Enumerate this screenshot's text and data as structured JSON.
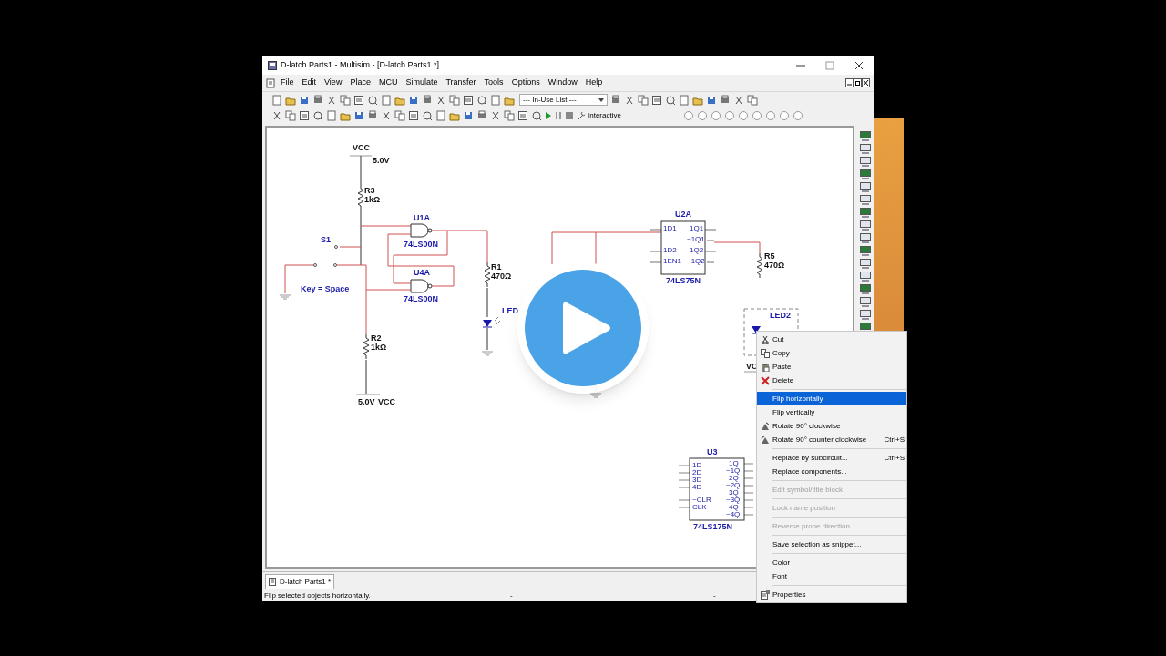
{
  "window": {
    "title": "D-latch Parts1 - Multisim - [D-latch Parts1 *]"
  },
  "menu": [
    "File",
    "Edit",
    "View",
    "Place",
    "MCU",
    "Simulate",
    "Transfer",
    "Tools",
    "Options",
    "Window",
    "Help"
  ],
  "toolbar": {
    "dropdown": "--- In-Use List ---",
    "mode": "Interactive"
  },
  "schematic": {
    "labels": [
      {
        "text": "VCC",
        "kind": "value"
      },
      {
        "text": "5.0V",
        "kind": "value"
      },
      {
        "text": "R3",
        "kind": "value"
      },
      {
        "text": "1kΩ",
        "kind": "value"
      },
      {
        "text": "U1A",
        "kind": "part"
      },
      {
        "text": "S1",
        "kind": "part"
      },
      {
        "text": "74LS00N",
        "kind": "part"
      },
      {
        "text": "U4A",
        "kind": "part"
      },
      {
        "text": "74LS00N",
        "kind": "part"
      },
      {
        "text": "R1",
        "kind": "value"
      },
      {
        "text": "470Ω",
        "kind": "value"
      },
      {
        "text": "Key = Space",
        "kind": "part"
      },
      {
        "text": "LED",
        "kind": "part"
      },
      {
        "text": "R2",
        "kind": "value"
      },
      {
        "text": "1kΩ",
        "kind": "value"
      },
      {
        "text": "5.0V",
        "kind": "value"
      },
      {
        "text": "VCC",
        "kind": "value"
      },
      {
        "text": "U2A",
        "kind": "part"
      },
      {
        "text": "1D1",
        "kind": "pin"
      },
      {
        "text": "1D2",
        "kind": "pin"
      },
      {
        "text": "1EN1",
        "kind": "pin"
      },
      {
        "text": "1Q1",
        "kind": "pin"
      },
      {
        "text": "~1Q1",
        "kind": "pin"
      },
      {
        "text": "1Q2",
        "kind": "pin"
      },
      {
        "text": "~1Q2",
        "kind": "pin"
      },
      {
        "text": "74LS75N",
        "kind": "part"
      },
      {
        "text": "R5",
        "kind": "value"
      },
      {
        "text": "470Ω",
        "kind": "value"
      },
      {
        "text": "LED2",
        "kind": "part"
      },
      {
        "text": "VC",
        "kind": "value"
      },
      {
        "text": "U3",
        "kind": "part"
      },
      {
        "text": "1D",
        "kind": "pin"
      },
      {
        "text": "2D",
        "kind": "pin"
      },
      {
        "text": "3D",
        "kind": "pin"
      },
      {
        "text": "4D",
        "kind": "pin"
      },
      {
        "text": "~CLR",
        "kind": "pin"
      },
      {
        "text": "CLK",
        "kind": "pin"
      },
      {
        "text": "1Q",
        "kind": "pin"
      },
      {
        "text": "~1Q",
        "kind": "pin"
      },
      {
        "text": "2Q",
        "kind": "pin"
      },
      {
        "text": "~2Q",
        "kind": "pin"
      },
      {
        "text": "3Q",
        "kind": "pin"
      },
      {
        "text": "~3Q",
        "kind": "pin"
      },
      {
        "text": "4Q",
        "kind": "pin"
      },
      {
        "text": "~4Q",
        "kind": "pin"
      },
      {
        "text": "74LS175N",
        "kind": "part"
      }
    ]
  },
  "document_tabs": [
    {
      "label": "D-latch Parts1 *",
      "selected": true
    }
  ],
  "status_bar": {
    "message": "Flip selected objects horizontally.",
    "field_2": "-",
    "field_3": "-"
  },
  "context_menu": {
    "sections": [
      [
        {
          "label": "Cut",
          "selected": false,
          "disabled": false
        },
        {
          "label": "Copy",
          "selected": false,
          "disabled": false
        },
        {
          "label": "Paste",
          "selected": false,
          "disabled": false
        },
        {
          "label": "Delete",
          "selected": false,
          "disabled": false
        }
      ],
      [
        {
          "label": "Flip horizontally",
          "selected": true,
          "disabled": false
        },
        {
          "label": "Flip vertically",
          "selected": false,
          "disabled": false
        },
        {
          "label": "Rotate 90° clockwise",
          "selected": false,
          "disabled": false
        },
        {
          "label": "Rotate 90° counter clockwise",
          "shortcut": "Ctrl+S",
          "selected": false,
          "disabled": false
        }
      ],
      [
        {
          "label": "Replace by subcircuit...",
          "shortcut": "Ctrl+S",
          "selected": false,
          "disabled": false
        },
        {
          "label": "Replace components...",
          "selected": false,
          "disabled": false
        }
      ],
      [
        {
          "label": "Edit symbol/title block",
          "selected": false,
          "disabled": true
        }
      ],
      [
        {
          "label": "Lock name position",
          "selected": false,
          "disabled": true
        }
      ],
      [
        {
          "label": "Reverse probe direction",
          "selected": false,
          "disabled": true
        }
      ],
      [
        {
          "label": "Save selection as snippet...",
          "selected": false,
          "disabled": false
        }
      ],
      [
        {
          "label": "Color",
          "selected": false,
          "disabled": false
        },
        {
          "label": "Font",
          "selected": false,
          "disabled": false
        }
      ],
      [
        {
          "label": "Properties",
          "selected": false,
          "disabled": false
        }
      ]
    ]
  }
}
